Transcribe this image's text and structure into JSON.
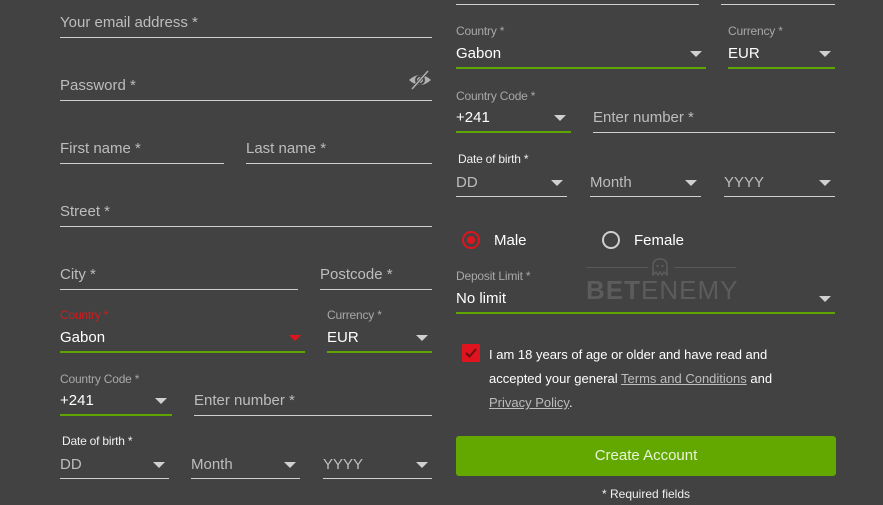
{
  "left_form": {
    "email": {
      "placeholder": "Your email address *"
    },
    "password": {
      "placeholder": "Password *",
      "icon": "eye-slash-icon"
    },
    "first_name": {
      "placeholder": "First name *"
    },
    "last_name": {
      "placeholder": "Last name *"
    },
    "street": {
      "placeholder": "Street *"
    },
    "city": {
      "placeholder": "City *"
    },
    "postcode": {
      "placeholder": "Postcode *"
    },
    "country": {
      "label": "Country *",
      "value": "Gabon",
      "state": "error"
    },
    "currency": {
      "label": "Currency *",
      "value": "EUR"
    },
    "country_code": {
      "label": "Country Code *",
      "value": "+241"
    },
    "phone": {
      "placeholder": "Enter number *"
    },
    "dob": {
      "label": "Date of birth *",
      "day": "DD",
      "month": "Month",
      "year": "YYYY"
    }
  },
  "right_form": {
    "country": {
      "label": "Country *",
      "value": "Gabon"
    },
    "currency": {
      "label": "Currency *",
      "value": "EUR"
    },
    "country_code": {
      "label": "Country Code *",
      "value": "+241"
    },
    "phone": {
      "placeholder": "Enter number *"
    },
    "dob": {
      "label": "Date of birth *",
      "day": "DD",
      "month": "Month",
      "year": "YYYY"
    },
    "gender": {
      "options": [
        {
          "label": "Male",
          "selected": true
        },
        {
          "label": "Female",
          "selected": false
        }
      ]
    },
    "deposit_limit": {
      "label": "Deposit Limit *",
      "value": "No limit"
    },
    "terms": {
      "checked": true,
      "text_1": "I am 18 years of age or older and have read and accepted your general ",
      "link_terms": "Terms and Conditions",
      "text_2": " and ",
      "link_privacy": "Privacy Policy",
      "text_3": "."
    },
    "submit_label": "Create Account",
    "required_note": "* Required fields"
  },
  "watermark": {
    "bold": "BET",
    "light": "ENEMY"
  },
  "colors": {
    "accent_green": "#62a800",
    "error_red": "#e0141e",
    "background": "#424242"
  }
}
